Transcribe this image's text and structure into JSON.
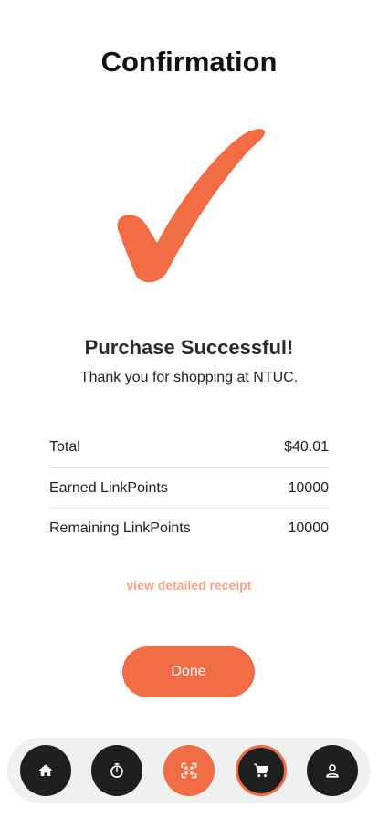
{
  "header": {
    "title": "Confirmation"
  },
  "status": {
    "icon": "checkmark-icon",
    "headline": "Purchase Successful!",
    "message": "Thank you for shopping at NTUC."
  },
  "summary": {
    "rows": [
      {
        "label": "Total",
        "value": "$40.01"
      },
      {
        "label": "Earned LinkPoints",
        "value": "10000"
      },
      {
        "label": "Remaining LinkPoints",
        "value": "10000"
      }
    ]
  },
  "actions": {
    "receipt_link": "view detailed receipt",
    "done_label": "Done"
  },
  "bottom_nav": {
    "items": [
      {
        "icon": "home-icon"
      },
      {
        "icon": "timer-icon"
      },
      {
        "icon": "qr-scan-icon",
        "active": true
      },
      {
        "icon": "cart-icon",
        "selected": true
      },
      {
        "icon": "profile-icon"
      }
    ]
  },
  "colors": {
    "accent": "#f26d46",
    "link": "#f4a68a",
    "nav_button": "#1f1f1f",
    "nav_bar": "#f0f0f0"
  }
}
